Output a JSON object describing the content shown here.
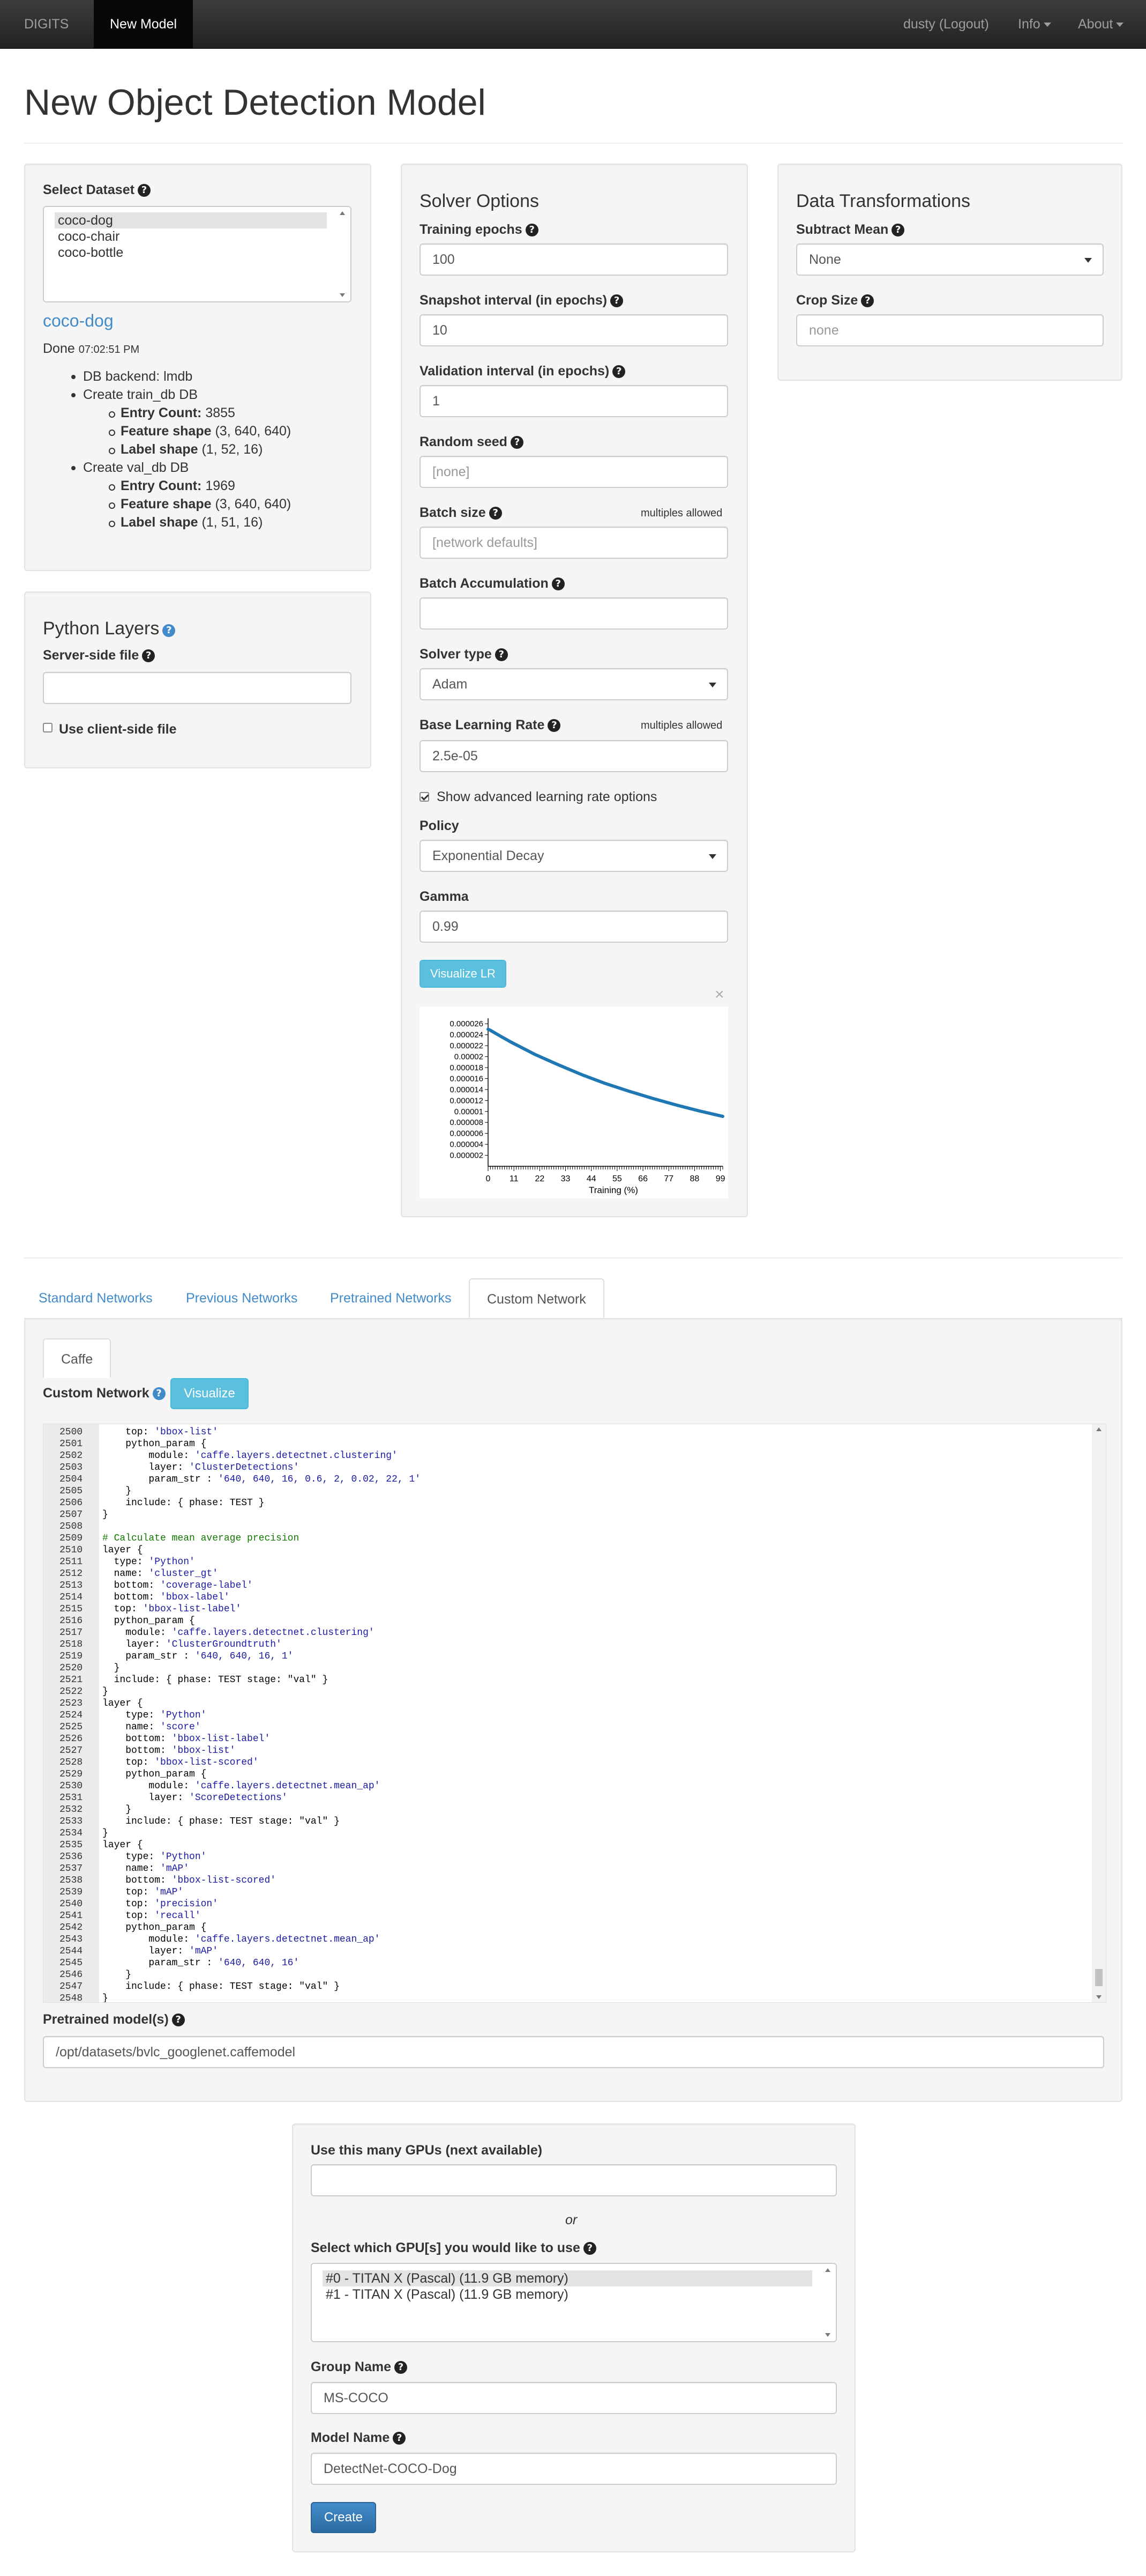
{
  "navbar": {
    "brand": "DIGITS",
    "active_item": "New Model",
    "user": "dusty (Logout)",
    "info": "Info",
    "about": "About"
  },
  "page": {
    "title": "New Object Detection Model"
  },
  "dataset": {
    "label": "Select Dataset",
    "options": [
      "coco-dog",
      "coco-chair",
      "coco-bottle"
    ],
    "selected_index": 0,
    "name": "coco-dog",
    "status": "Done",
    "status_time": "07:02:51 PM",
    "backend_label": "DB backend:",
    "backend_value": "lmdb",
    "train_db": {
      "title": "Create train_db DB",
      "entry_count_label": "Entry Count:",
      "entry_count": "3855",
      "feature_shape_label": "Feature shape",
      "feature_shape": "(3, 640, 640)",
      "label_shape_label": "Label shape",
      "label_shape": "(1, 52, 16)"
    },
    "val_db": {
      "title": "Create val_db DB",
      "entry_count_label": "Entry Count:",
      "entry_count": "1969",
      "feature_shape_label": "Feature shape",
      "feature_shape": "(3, 640, 640)",
      "label_shape_label": "Label shape",
      "label_shape": "(1, 51, 16)"
    }
  },
  "python_layers": {
    "title": "Python Layers",
    "server_side_label": "Server-side file",
    "server_side_value": "",
    "client_side_label": "Use client-side file",
    "client_side_checked": false
  },
  "solver": {
    "title": "Solver Options",
    "training_epochs_label": "Training epochs",
    "training_epochs": "100",
    "snapshot_label": "Snapshot interval (in epochs)",
    "snapshot": "10",
    "validation_label": "Validation interval (in epochs)",
    "validation": "1",
    "seed_label": "Random seed",
    "seed_placeholder": "[none]",
    "batch_size_label": "Batch size",
    "batch_size_note": "multiples allowed",
    "batch_size_placeholder": "[network defaults]",
    "batch_accum_label": "Batch Accumulation",
    "batch_accum": "",
    "solver_type_label": "Solver type",
    "solver_type": "Adam",
    "base_lr_label": "Base Learning Rate",
    "base_lr_note": "multiples allowed",
    "base_lr": "2.5e-05",
    "advanced_label": "Show advanced learning rate options",
    "advanced_checked": true,
    "policy_label": "Policy",
    "policy": "Exponential Decay",
    "gamma_label": "Gamma",
    "gamma": "0.99",
    "visualize_button": "Visualize LR",
    "close_symbol": "×"
  },
  "transforms": {
    "title": "Data Transformations",
    "subtract_mean_label": "Subtract Mean",
    "subtract_mean": "None",
    "crop_size_label": "Crop Size",
    "crop_size_placeholder": "none"
  },
  "network_tabs": [
    "Standard Networks",
    "Previous Networks",
    "Pretrained Networks",
    "Custom Network"
  ],
  "network_active_tab": 3,
  "custom_network": {
    "framework_tab": "Caffe",
    "label": "Custom Network",
    "visualize_button": "Visualize",
    "pretrained_label": "Pretrained model(s)",
    "pretrained_value": "/opt/datasets/bvlc_googlenet.caffemodel",
    "code_lines": [
      [
        "2500",
        "    top: 'bbox-list'"
      ],
      [
        "2501",
        "    python_param {"
      ],
      [
        "2502",
        "        module: 'caffe.layers.detectnet.clustering'"
      ],
      [
        "2503",
        "        layer: 'ClusterDetections'"
      ],
      [
        "2504",
        "        param_str : '640, 640, 16, 0.6, 2, 0.02, 22, 1'"
      ],
      [
        "2505",
        "    }"
      ],
      [
        "2506",
        "    include: { phase: TEST }"
      ],
      [
        "2507",
        "}"
      ],
      [
        "2508",
        ""
      ],
      [
        "2509",
        "# Calculate mean average precision"
      ],
      [
        "2510",
        "layer {"
      ],
      [
        "2511",
        "  type: 'Python'"
      ],
      [
        "2512",
        "  name: 'cluster_gt'"
      ],
      [
        "2513",
        "  bottom: 'coverage-label'"
      ],
      [
        "2514",
        "  bottom: 'bbox-label'"
      ],
      [
        "2515",
        "  top: 'bbox-list-label'"
      ],
      [
        "2516",
        "  python_param {"
      ],
      [
        "2517",
        "    module: 'caffe.layers.detectnet.clustering'"
      ],
      [
        "2518",
        "    layer: 'ClusterGroundtruth'"
      ],
      [
        "2519",
        "    param_str : '640, 640, 16, 1'"
      ],
      [
        "2520",
        "  }"
      ],
      [
        "2521",
        "  include: { phase: TEST stage: \"val\" }"
      ],
      [
        "2522",
        "}"
      ],
      [
        "2523",
        "layer {"
      ],
      [
        "2524",
        "    type: 'Python'"
      ],
      [
        "2525",
        "    name: 'score'"
      ],
      [
        "2526",
        "    bottom: 'bbox-list-label'"
      ],
      [
        "2527",
        "    bottom: 'bbox-list'"
      ],
      [
        "2528",
        "    top: 'bbox-list-scored'"
      ],
      [
        "2529",
        "    python_param {"
      ],
      [
        "2530",
        "        module: 'caffe.layers.detectnet.mean_ap'"
      ],
      [
        "2531",
        "        layer: 'ScoreDetections'"
      ],
      [
        "2532",
        "    }"
      ],
      [
        "2533",
        "    include: { phase: TEST stage: \"val\" }"
      ],
      [
        "2534",
        "}"
      ],
      [
        "2535",
        "layer {"
      ],
      [
        "2536",
        "    type: 'Python'"
      ],
      [
        "2537",
        "    name: 'mAP'"
      ],
      [
        "2538",
        "    bottom: 'bbox-list-scored'"
      ],
      [
        "2539",
        "    top: 'mAP'"
      ],
      [
        "2540",
        "    top: 'precision'"
      ],
      [
        "2541",
        "    top: 'recall'"
      ],
      [
        "2542",
        "    python_param {"
      ],
      [
        "2543",
        "        module: 'caffe.layers.detectnet.mean_ap'"
      ],
      [
        "2544",
        "        layer: 'mAP'"
      ],
      [
        "2545",
        "        param_str : '640, 640, 16'"
      ],
      [
        "2546",
        "    }"
      ],
      [
        "2547",
        "    include: { phase: TEST stage: \"val\" }"
      ],
      [
        "2548",
        "}"
      ]
    ]
  },
  "gpu": {
    "many_label": "Use this many GPUs (next available)",
    "many_value": "",
    "or_text": "or",
    "which_label": "Select which GPU[s] you would like to use",
    "options": [
      "#0 - TITAN X (Pascal) (11.9 GB memory)",
      "#1 - TITAN X (Pascal) (11.9 GB memory)"
    ],
    "selected_index": 0,
    "group_label": "Group Name",
    "group_value": "MS-COCO",
    "model_label": "Model Name",
    "model_value": "DetectNet-COCO-Dog",
    "create_button": "Create"
  },
  "colors": {
    "accent": "#428bca",
    "line": "#1f77b4",
    "info_button": "#5bc0de",
    "primary_button": "#3071a9"
  },
  "chart_data": {
    "type": "line",
    "xlabel": "Training (%)",
    "ylabel": "",
    "x_ticks": [
      0,
      11,
      22,
      33,
      44,
      55,
      66,
      77,
      88,
      99
    ],
    "y_ticks": [
      "0.000002",
      "0.000004",
      "0.000006",
      "0.000008",
      "0.00001",
      "0.000012",
      "0.000014",
      "0.000016",
      "0.000018",
      "0.00002",
      "0.000022",
      "0.000024",
      "0.000026"
    ],
    "xlim": [
      0,
      100
    ],
    "ylim": [
      0,
      2.7e-05
    ],
    "series": [
      {
        "values_x": [
          0,
          1,
          5,
          10,
          20,
          30,
          40,
          50,
          60,
          70,
          80,
          90,
          100
        ],
        "values_y": [
          2.5e-05,
          2.48e-05,
          2.38e-05,
          2.26e-05,
          2.04e-05,
          1.85e-05,
          1.67e-05,
          1.51e-05,
          1.37e-05,
          1.24e-05,
          1.12e-05,
          1.01e-05,
          9.1e-06
        ]
      }
    ]
  }
}
